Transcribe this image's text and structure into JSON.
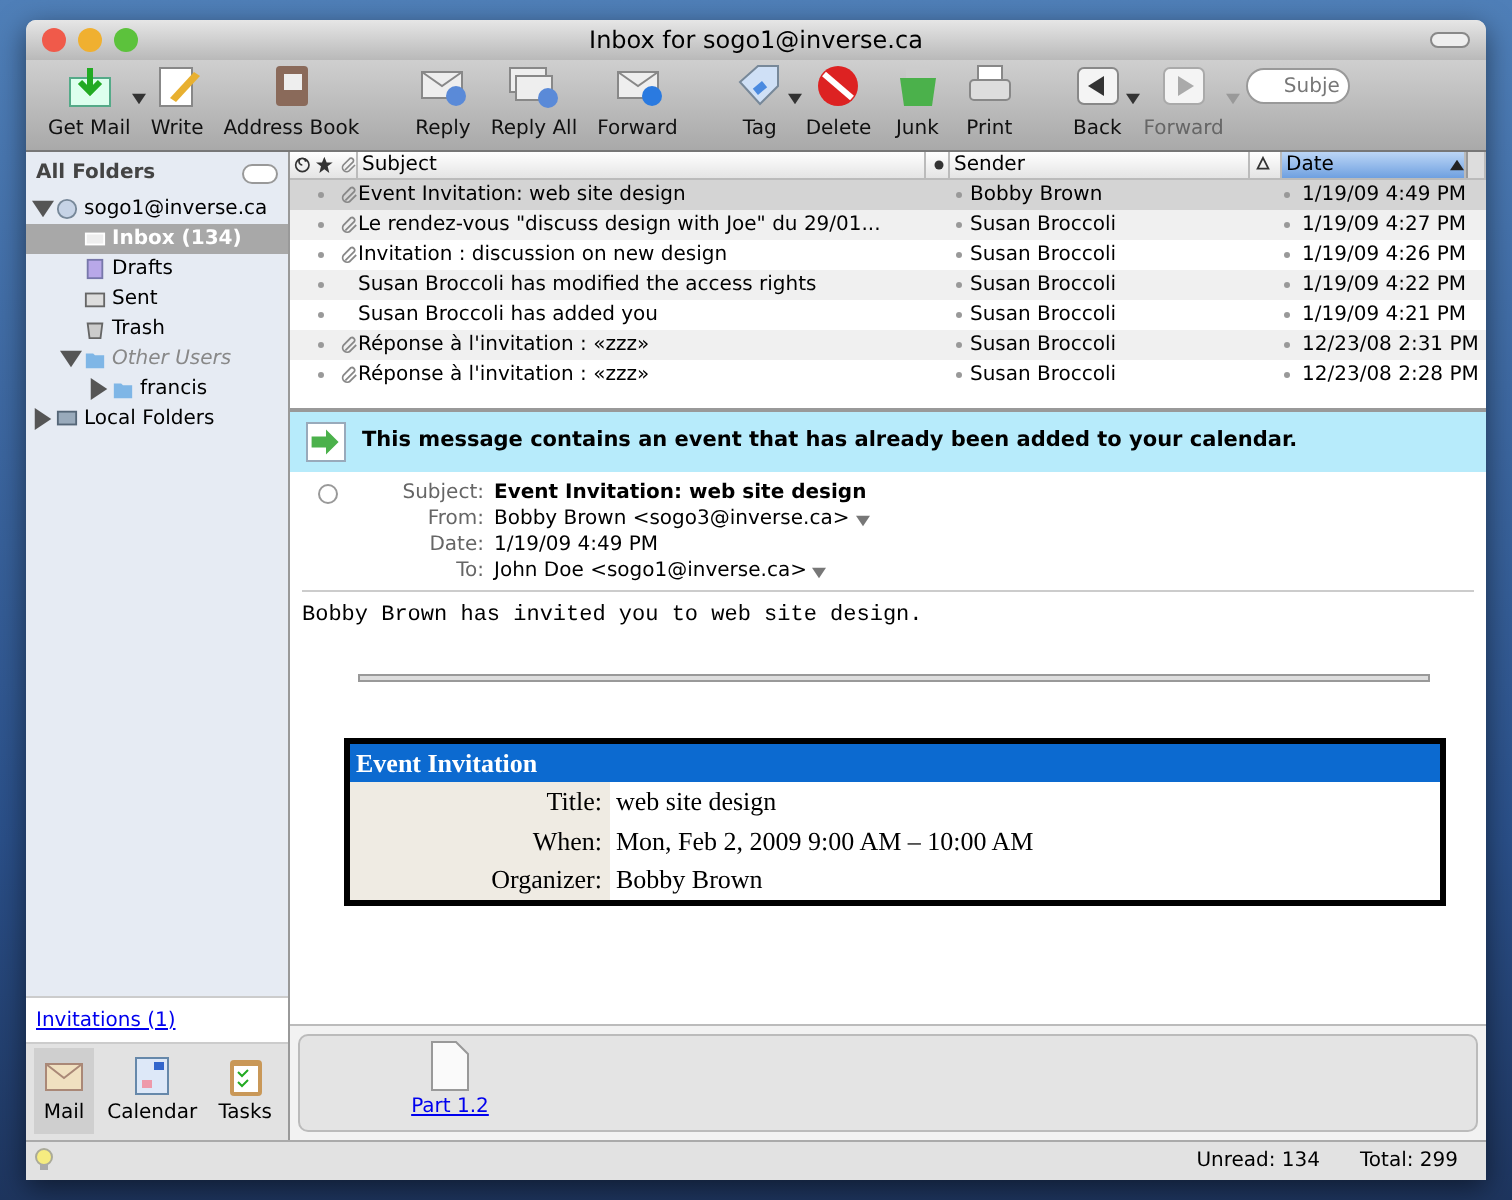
{
  "window": {
    "title": "Inbox for sogo1@inverse.ca"
  },
  "toolbar": [
    {
      "label": "Get Mail",
      "kind": "getmail",
      "dropdown": true
    },
    {
      "label": "Write",
      "kind": "write",
      "dropdown": false
    },
    {
      "label": "Address Book",
      "kind": "addressbook",
      "dropdown": false
    },
    {
      "label": "Reply",
      "kind": "reply",
      "dropdown": false
    },
    {
      "label": "Reply All",
      "kind": "replyall",
      "dropdown": false
    },
    {
      "label": "Forward",
      "kind": "forward",
      "dropdown": false
    },
    {
      "label": "Tag",
      "kind": "tag",
      "dropdown": true
    },
    {
      "label": "Delete",
      "kind": "delete",
      "dropdown": false
    },
    {
      "label": "Junk",
      "kind": "junk",
      "dropdown": false
    },
    {
      "label": "Print",
      "kind": "print",
      "dropdown": false
    },
    {
      "label": "Back",
      "kind": "back",
      "dropdown": true,
      "disabled": false
    },
    {
      "label": "Forward",
      "kind": "next",
      "dropdown": true,
      "disabled": true
    }
  ],
  "search": {
    "placeholder": "Subje"
  },
  "sidebar": {
    "title": "All Folders",
    "folders": [
      {
        "label": "sogo1@inverse.ca",
        "kind": "account",
        "expanded": true,
        "selected": false,
        "children": [
          {
            "label": "Inbox (134)",
            "kind": "inbox",
            "selected": true
          },
          {
            "label": "Drafts",
            "kind": "drafts",
            "selected": false
          },
          {
            "label": "Sent",
            "kind": "sent",
            "selected": false
          },
          {
            "label": "Trash",
            "kind": "trash",
            "selected": false
          },
          {
            "label": "Other Users",
            "kind": "group",
            "expanded": true,
            "selected": false,
            "children": [
              {
                "label": "francis",
                "kind": "folder",
                "expanded": false,
                "selected": false
              }
            ]
          }
        ]
      },
      {
        "label": "Local Folders",
        "kind": "local",
        "expanded": false,
        "selected": false
      }
    ],
    "link": "Invitations (1)",
    "modes": [
      {
        "label": "Mail",
        "kind": "mail",
        "selected": true
      },
      {
        "label": "Calendar",
        "kind": "calendar",
        "selected": false
      },
      {
        "label": "Tasks",
        "kind": "tasks",
        "selected": false
      }
    ]
  },
  "message_list": {
    "columns": {
      "subject": "Subject",
      "sender": "Sender",
      "date": "Date"
    },
    "rows": [
      {
        "subject": "Event Invitation: web site design",
        "sender": "Bobby Brown",
        "date": "1/19/09 4:49 PM",
        "attachment": true,
        "selected": true
      },
      {
        "subject": "Le rendez-vous \"discuss design with Joe\" du 29/01...",
        "sender": "Susan Broccoli",
        "date": "1/19/09 4:27 PM",
        "attachment": true,
        "selected": false
      },
      {
        "subject": "Invitation : discussion on new design",
        "sender": "Susan Broccoli",
        "date": "1/19/09 4:26 PM",
        "attachment": true,
        "selected": false
      },
      {
        "subject": "Susan Broccoli has modified the access rights",
        "sender": "Susan Broccoli",
        "date": "1/19/09 4:22 PM",
        "attachment": false,
        "selected": false
      },
      {
        "subject": "Susan Broccoli has added you",
        "sender": "Susan Broccoli",
        "date": "1/19/09 4:21 PM",
        "attachment": false,
        "selected": false
      },
      {
        "subject": "Réponse à l'invitation : «zzz»",
        "sender": "Susan Broccoli",
        "date": "12/23/08 2:31 PM",
        "attachment": true,
        "selected": false
      },
      {
        "subject": "Réponse à l'invitation : «zzz»",
        "sender": "Susan Broccoli",
        "date": "12/23/08 2:28 PM",
        "attachment": true,
        "selected": false
      }
    ]
  },
  "message": {
    "banner": "This message contains an event that has already been added to your calendar.",
    "headers": [
      {
        "label": "Subject:",
        "value": "Event Invitation: web site design",
        "kind": "subject"
      },
      {
        "label": "From:",
        "value": "Bobby Brown <sogo3@inverse.ca>",
        "kind": "address"
      },
      {
        "label": "Date:",
        "value": "1/19/09 4:49 PM",
        "kind": "plain"
      },
      {
        "label": "To:",
        "value": "John Doe <sogo1@inverse.ca>",
        "kind": "address"
      }
    ],
    "body": "Bobby Brown has invited you to web site design.",
    "invitation": {
      "title": "Event Invitation",
      "rows": [
        {
          "label": "Title:",
          "value": "web site design"
        },
        {
          "label": "When:",
          "value": "Mon, Feb 2, 2009 9:00 AM – 10:00 AM"
        },
        {
          "label": "Organizer:",
          "value": "Bobby Brown"
        }
      ]
    },
    "attachments": [
      "Part 1.2"
    ]
  },
  "status_bar": {
    "unread": "Unread: 134",
    "total": "Total: 299"
  }
}
